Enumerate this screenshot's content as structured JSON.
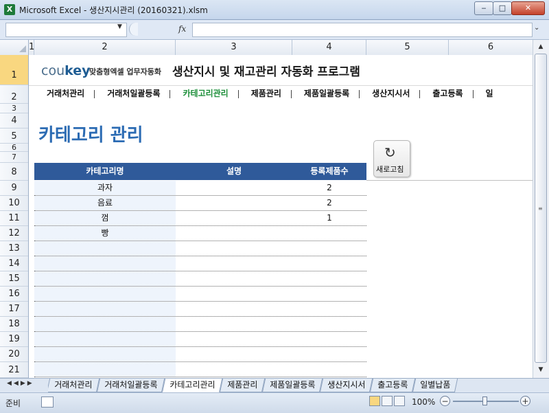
{
  "window": {
    "app_icon": "X",
    "title": "Microsoft Excel - 생산지시관리 (20160321).xlsm",
    "minimize": "‒",
    "maximize": "□",
    "close": "✕"
  },
  "formula_bar": {
    "namebox_value": "",
    "fx": "fx",
    "formula_value": ""
  },
  "columns": [
    "1",
    "2",
    "3",
    "4",
    "5",
    "6"
  ],
  "rows": [
    "1",
    "2",
    "3",
    "4",
    "5",
    "6",
    "7",
    "8",
    "9",
    "10",
    "11",
    "12",
    "13",
    "14",
    "15",
    "16",
    "17",
    "18",
    "19",
    "20",
    "21"
  ],
  "header": {
    "logo_cou": "cou",
    "logo_key": "key",
    "tagline": "맞춤형엑셀 업무자동화",
    "title": "생산지시 및 재고관리 자동화 프로그램"
  },
  "nav": [
    "거래처관리",
    "거래처일괄등록",
    "카테고리관리",
    "제품관리",
    "제품일괄등록",
    "생산지시서",
    "출고등록",
    "일"
  ],
  "nav_active_index": 2,
  "section_title": "카테고리 관리",
  "refresh_button": {
    "label": "새로고침",
    "icon": "refresh-icon"
  },
  "table": {
    "headers": [
      "카테고리명",
      "설명",
      "등록제품수"
    ],
    "rows": [
      [
        "과자",
        "",
        "2"
      ],
      [
        "음료",
        "",
        "2"
      ],
      [
        "껌",
        "",
        "1"
      ],
      [
        "빵",
        "",
        ""
      ],
      [
        "",
        "",
        ""
      ],
      [
        "",
        "",
        ""
      ],
      [
        "",
        "",
        ""
      ],
      [
        "",
        "",
        ""
      ],
      [
        "",
        "",
        ""
      ],
      [
        "",
        "",
        ""
      ],
      [
        "",
        "",
        ""
      ],
      [
        "",
        "",
        ""
      ],
      [
        "",
        "",
        ""
      ]
    ]
  },
  "sheet_tabs": [
    "거래처관리",
    "거래처일괄등록",
    "카테고리관리",
    "제품관리",
    "제품일괄등록",
    "생산지시서",
    "출고등록",
    "일별납품"
  ],
  "active_tab_index": 2,
  "status": {
    "ready": "준비",
    "zoom": "100%",
    "zoom_out": "−",
    "zoom_in": "+"
  },
  "colors": {
    "table_header": "#2f5a9a",
    "section_title": "#2b6bb3",
    "nav_active": "#1d8f3a"
  }
}
